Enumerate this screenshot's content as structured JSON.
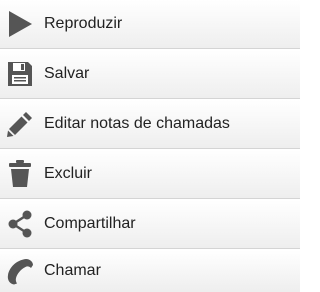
{
  "menu": {
    "icon_color": "#555555",
    "items": [
      {
        "label": "Reproduzir",
        "icon": "play-icon"
      },
      {
        "label": "Salvar",
        "icon": "save-icon"
      },
      {
        "label": "Editar notas de chamadas",
        "icon": "pencil-icon"
      },
      {
        "label": "Excluir",
        "icon": "trash-icon"
      },
      {
        "label": "Compartilhar",
        "icon": "share-icon"
      },
      {
        "label": "Chamar",
        "icon": "phone-icon"
      }
    ]
  }
}
